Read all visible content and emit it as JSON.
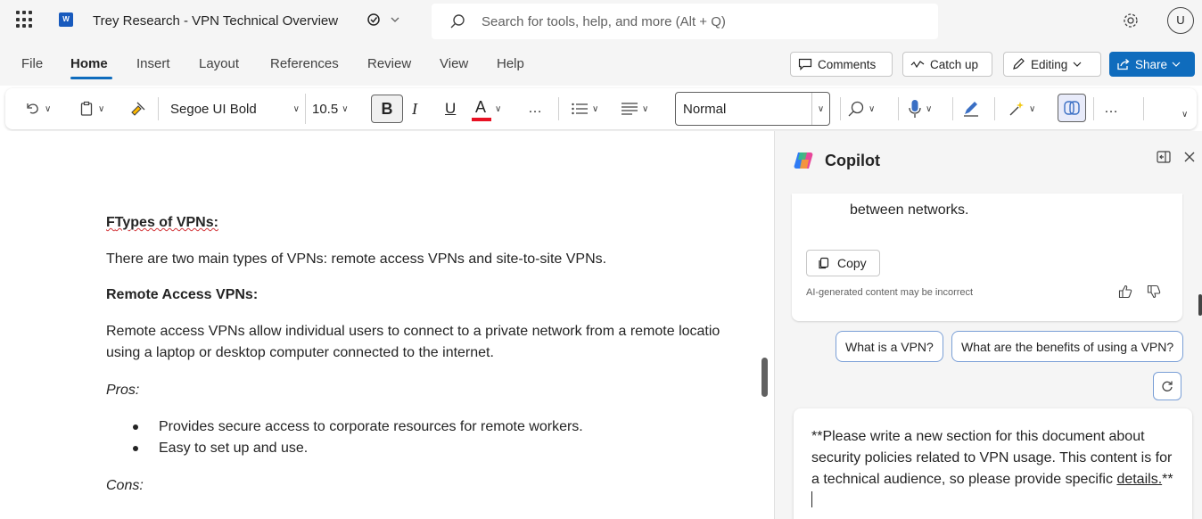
{
  "app": {
    "doc_title": "Trey Research - VPN Technical Overview",
    "search_placeholder": "Search for tools, help, and more (Alt + Q)",
    "user_initial": "U"
  },
  "menu": {
    "tabs": [
      "File",
      "Home",
      "Insert",
      "Layout",
      "References",
      "Review",
      "View",
      "Help"
    ],
    "active_tab": "Home",
    "comments_label": "Comments",
    "catchup_label": "Catch up",
    "editing_label": "Editing",
    "share_label": "Share"
  },
  "toolbar": {
    "font_name": "Segoe UI Bold",
    "font_size": "10.5",
    "bold_label": "B",
    "italic_label": "I",
    "underline_label": "U",
    "font_color_label": "A",
    "style_name": "Normal",
    "font_color": "#e81123"
  },
  "document": {
    "types_heading_prefix": "F",
    "types_heading_rest": "Types of VPNs:",
    "types_para": "There are two main types of VPNs: remote access VPNs and site-to-site VPNs.",
    "remote_heading": "Remote Access VPNs:",
    "remote_para_line1": "Remote access VPNs allow individual users to connect to a private network from a remote locatio",
    "remote_para_line2": "using a laptop or desktop computer connected to the internet.",
    "pros_label": "Pros:",
    "pros": [
      "Provides secure access to corporate resources for remote workers.",
      "Easy to set up and use."
    ],
    "cons_label": "Cons:"
  },
  "copilot": {
    "title": "Copilot",
    "response_tail": "between networks.",
    "copy_label": "Copy",
    "disclaimer": "AI-generated content may be incorrect",
    "suggestions": [
      "What is a VPN?",
      "What are the benefits of using a VPN?"
    ],
    "prompt_main": "**Please write a new section for this document about security policies related to VPN usage. This content is for a technical audience, so please provide specific ",
    "prompt_underlined": "details.",
    "prompt_end": "**"
  },
  "colors": {
    "accent": "#0f6cbd",
    "suggestion_border": "#7a9fd6",
    "spell_error": "#d13438"
  }
}
